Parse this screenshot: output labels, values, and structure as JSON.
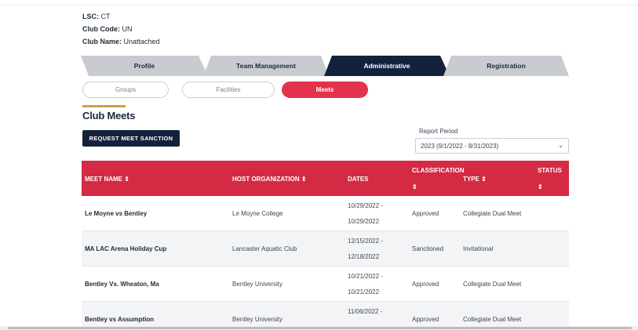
{
  "club": {
    "lsc_label": "LSC:",
    "lsc_value": "CT",
    "code_label": "Club Code:",
    "code_value": "UN",
    "name_label": "Club Name:",
    "name_value": "Unattached"
  },
  "tabs": [
    {
      "label": "Profile",
      "active": false
    },
    {
      "label": "Team Management",
      "active": false
    },
    {
      "label": "Administrative",
      "active": true
    },
    {
      "label": "Registration",
      "active": false
    }
  ],
  "subnav": [
    {
      "label": "Groups",
      "active": false
    },
    {
      "label": "Facilities",
      "active": false
    },
    {
      "label": "Meets",
      "active": true
    }
  ],
  "page": {
    "title": "Club Meets",
    "request_button": "REQUEST MEET SANCTION",
    "report_period_label": "Report Period",
    "report_period_value": "2023 (9/1/2022 - 8/31/2023)"
  },
  "table": {
    "headers": {
      "meet_name": "MEET NAME",
      "host": "HOST ORGANIZATION",
      "dates": "DATES",
      "classification": "CLASSIFICATION",
      "type": "TYPE",
      "status": "STATUS"
    },
    "sort_icon": "sort-arrows-icon",
    "rows": [
      {
        "name": "Le Moyne vs Bentley",
        "host": "Le Moyne College",
        "date_start": "10/29/2022 -",
        "date_end": "10/29/2022",
        "classification": "Approved",
        "type": "Collegiate Dual Meet"
      },
      {
        "name": "MA LAC Arena Holiday Cup",
        "host": "Lancaster Aquatic Club",
        "date_start": "12/15/2022 -",
        "date_end": "12/18/2022",
        "classification": "Sanctioned",
        "type": "Invitational"
      },
      {
        "name": "Bentley Vs. Wheaton, Ma",
        "host": "Bentley University",
        "date_start": "10/21/2022 -",
        "date_end": "10/21/2022",
        "classification": "Approved",
        "type": "Collegiate Dual Meet"
      },
      {
        "name": "Bentley vs Assumption",
        "host": "Bentley University",
        "date_start": "11/06/2022 -",
        "date_end": "",
        "classification": "Approved",
        "type": "Collegiate Dual Meet"
      }
    ]
  },
  "colors": {
    "navy": "#14213d",
    "accent_red": "#e3334c",
    "header_red": "#d42a43",
    "tab_gray": "#c8ccd1",
    "gold": "#c9a14a"
  }
}
